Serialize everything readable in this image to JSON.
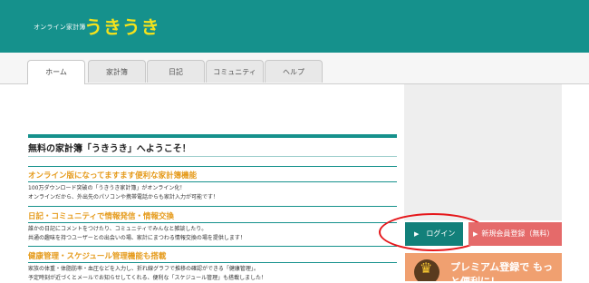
{
  "header": {
    "logo_sub": "オンライン家計簿",
    "logo_main": "うきうき"
  },
  "nav": {
    "tabs": [
      {
        "label": "ホーム",
        "active": true
      },
      {
        "label": "家計簿"
      },
      {
        "label": "日記"
      },
      {
        "label": "コミュニティ"
      },
      {
        "label": "ヘルプ"
      }
    ]
  },
  "main": {
    "welcome": "無料の家計簿「うきうき」へようこそ！",
    "sections": [
      {
        "title": "オンライン版になってますます便利な家計簿機能",
        "lines": [
          "100万ダウンロード突破の「うきうき家計簿」がオンライン化！",
          "オンラインだから、外出先のパソコンや携帯電話からも家計入力が可能です！"
        ]
      },
      {
        "title": "日記・コミュニティで情報発信・情報交換",
        "lines": [
          "誰かの日記にコメントをつけたり、コミュニティでみんなと雑談したり。",
          "共通の趣味を持つユーザーとの出会いの場、家計にまつわる情報交換の場を提供します！"
        ]
      },
      {
        "title": "健康管理・スケジュール管理機能も搭載",
        "lines": [
          "家族の体重・体脂肪率・血圧などを入力し、折れ線グラフで推移の確認ができる「健康管理」。",
          "予定時刻が近づくとメールでお知らせしてくれる、便利な「スケジュール管理」も搭載しました！"
        ]
      }
    ]
  },
  "sidebar": {
    "login_label": "ログイン",
    "register_label": "新規会員登録（無料）",
    "premium_text": "プレミアム登録で もっと便利に！",
    "colors": {
      "login": "#12807a",
      "register": "#e56a6a",
      "premium": "#f0a070",
      "highlight": "#e5171b"
    }
  }
}
